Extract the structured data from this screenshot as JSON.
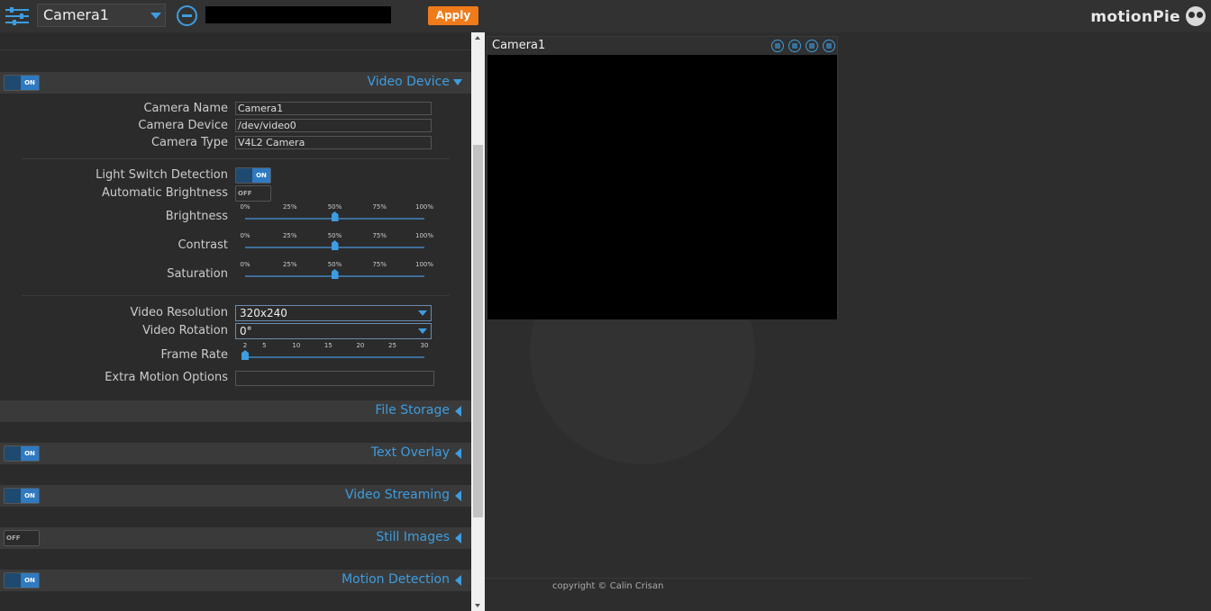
{
  "topbar": {
    "camera_select": "Camera1",
    "apply_label": "Apply",
    "brand": "motionPie"
  },
  "sections": {
    "video_device": {
      "title": "Video Device",
      "enabled": true
    },
    "file_storage": {
      "title": "File Storage"
    },
    "text_overlay": {
      "title": "Text Overlay",
      "enabled": true
    },
    "video_streaming": {
      "title": "Video Streaming",
      "enabled": true
    },
    "still_images": {
      "title": "Still Images",
      "enabled": false
    },
    "motion_detection": {
      "title": "Motion Detection",
      "enabled": true
    }
  },
  "toggle_labels": {
    "on": "ON",
    "off": "OFF"
  },
  "device": {
    "camera_name_label": "Camera Name",
    "camera_name": "Camera1",
    "camera_device_label": "Camera Device",
    "camera_device": "/dev/video0",
    "camera_type_label": "Camera Type",
    "camera_type": "V4L2 Camera",
    "light_switch_label": "Light Switch Detection",
    "light_switch": true,
    "auto_brightness_label": "Automatic Brightness",
    "auto_brightness": false,
    "brightness_label": "Brightness",
    "brightness_percent": 50,
    "contrast_label": "Contrast",
    "contrast_percent": 50,
    "saturation_label": "Saturation",
    "saturation_percent": 50,
    "percent_ticks": [
      "0%",
      "25%",
      "50%",
      "75%",
      "100%"
    ],
    "resolution_label": "Video Resolution",
    "resolution": "320x240",
    "rotation_label": "Video Rotation",
    "rotation": "0°",
    "frame_rate_label": "Frame Rate",
    "frame_rate": 2,
    "frame_rate_ticks": [
      "2",
      "5",
      "10",
      "15",
      "20",
      "25",
      "30"
    ],
    "extra_options_label": "Extra Motion Options",
    "extra_options": ""
  },
  "camera_view": {
    "title": "Camera1",
    "icons": [
      "frame-icon",
      "camera-icon",
      "play-icon",
      "wrench-icon"
    ]
  },
  "footer": {
    "copyright": "copyright © Calin Crisan"
  },
  "colors": {
    "accent": "#3d9de0",
    "apply": "#f07b1a",
    "background": "#2d2d2d"
  }
}
